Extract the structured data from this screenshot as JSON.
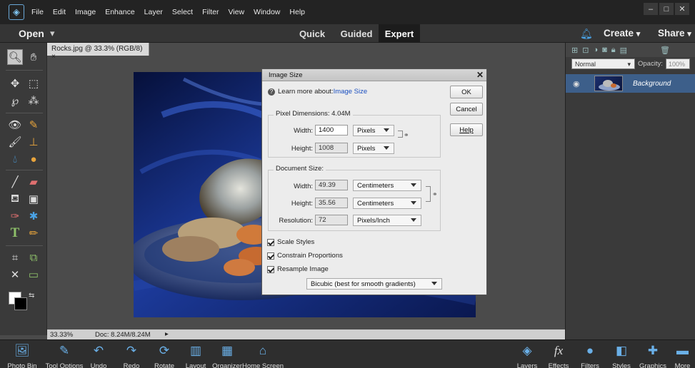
{
  "menubar": {
    "items": [
      "File",
      "Edit",
      "Image",
      "Enhance",
      "Layer",
      "Select",
      "Filter",
      "View",
      "Window",
      "Help"
    ],
    "window_controls": {
      "minimize": "–",
      "maximize": "□",
      "close": "✕"
    }
  },
  "modebar": {
    "open_label": "Open",
    "open_arrow": "▾",
    "tabs": [
      "Quick",
      "Guided",
      "Expert"
    ],
    "active_tab": "Expert",
    "create_label": "Create",
    "create_arrow": "▾",
    "share_label": "Share",
    "share_arrow": "▾",
    "icons": {
      "notifications": "bell-icon"
    }
  },
  "document": {
    "tab_title": "Rocks.jpg @ 33.3% (RGB/8)",
    "tab_close": "×",
    "zoom": "33.33%",
    "doc_size": "Doc: 8.24M/8.24M"
  },
  "dialog": {
    "title": "Image Size",
    "close": "✕",
    "learn_more_prefix": "Learn more about: ",
    "learn_more_link": "Image Size",
    "buttons": {
      "ok": "OK",
      "cancel": "Cancel",
      "help": "Help"
    },
    "pixel_dimensions": {
      "label": "Pixel Dimensions:",
      "size": "4.04M",
      "width_label": "Width:",
      "width_value": "1400",
      "width_unit": "Pixels",
      "height_label": "Height:",
      "height_value": "1008",
      "height_unit": "Pixels"
    },
    "document_size": {
      "label": "Document Size:",
      "width_label": "Width:",
      "width_value": "49.39",
      "width_unit": "Centimeters",
      "height_label": "Height:",
      "height_value": "35.56",
      "height_unit": "Centimeters",
      "resolution_label": "Resolution:",
      "resolution_value": "72",
      "resolution_unit": "Pixels/Inch"
    },
    "checkboxes": {
      "scale_styles": {
        "label": "Scale Styles",
        "checked": true
      },
      "constrain_proportions": {
        "label": "Constrain Proportions",
        "checked": true
      },
      "resample_image": {
        "label": "Resample Image",
        "checked": true
      }
    },
    "resample_method": "Bicubic (best for smooth gradients)"
  },
  "layers_panel": {
    "blend_mode": "Normal",
    "opacity_label": "Opacity:",
    "opacity_value": "100%",
    "layer_name": "Background"
  },
  "bottombar": {
    "left": [
      "Photo Bin",
      "Tool Options",
      "Undo",
      "Redo",
      "Rotate",
      "Layout",
      "Organizer",
      "Home Screen"
    ],
    "right": [
      "Layers",
      "Effects",
      "Filters",
      "Styles",
      "Graphics",
      "More"
    ]
  },
  "colors": {
    "accent": "#4aa3e6",
    "layer_selected": "#3d5f8a",
    "dialog_bg": "#ececec"
  }
}
